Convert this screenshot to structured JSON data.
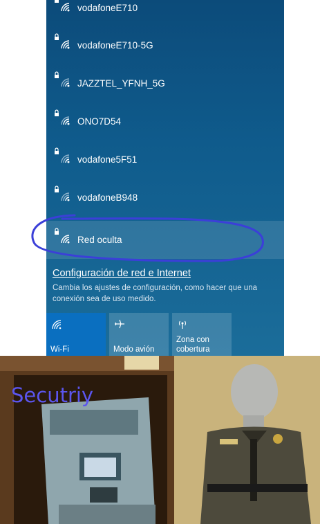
{
  "wifi_panel": {
    "networks": [
      {
        "name": "vodafoneE710"
      },
      {
        "name": "vodafoneE710-5G"
      },
      {
        "name": "JAZZTEL_YFNH_5G"
      },
      {
        "name": "ONO7D54"
      },
      {
        "name": "vodafone5F51"
      },
      {
        "name": "vodafoneB948"
      },
      {
        "name": "Red oculta",
        "selected": true
      }
    ],
    "settings_link": "Configuración de red e Internet",
    "settings_description": "Cambia los ajustes de configuración, como hacer que una conexión sea de uso medido.",
    "quick_actions": {
      "wifi": {
        "label": "Wi-Fi",
        "active": true
      },
      "airplane": {
        "label": "Modo avión",
        "active": false
      },
      "hotspot": {
        "label": "Zona con cobertura",
        "active": false
      }
    },
    "icons": [
      "secured-wifi-icon",
      "airplane-icon",
      "hotspot-icon"
    ],
    "colors": {
      "panel": "#0f5b8c",
      "active_tile": "#0a6fc0",
      "annotation_circle": "#3b3fd8"
    }
  },
  "photo": {
    "caption": "Secutriy",
    "caption_color": "#5b55ee"
  }
}
